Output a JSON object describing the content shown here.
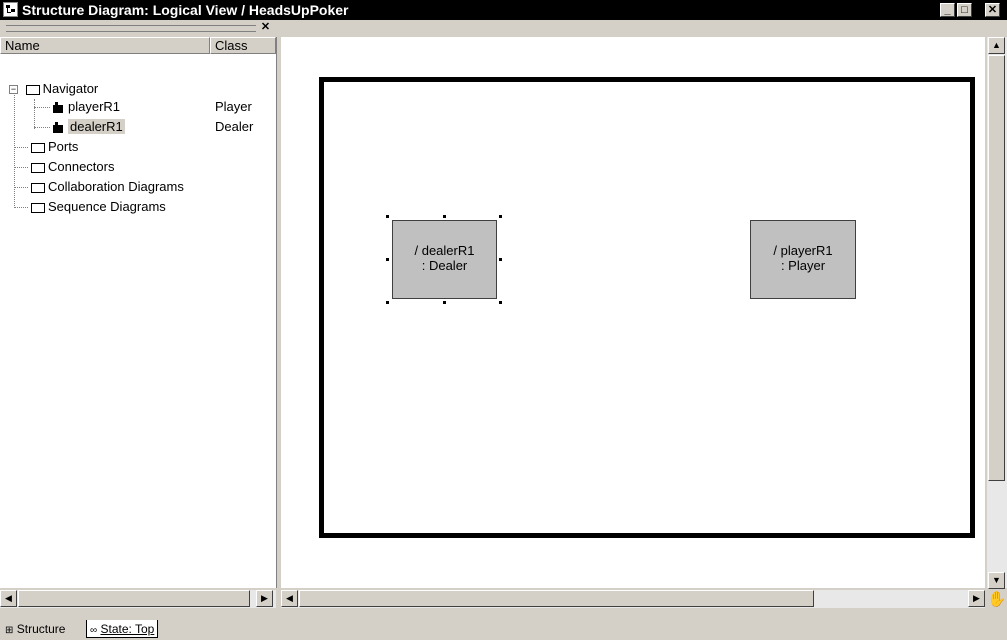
{
  "window": {
    "title": "Structure Diagram: Logical View / HeadsUpPoker",
    "minimize_label": "_",
    "maximize_label": "□",
    "close_label": "✕"
  },
  "browser": {
    "close_label": "✕",
    "columns": {
      "name": "Name",
      "class": "Class"
    },
    "tree": {
      "navigator": "Navigator",
      "parts": [
        {
          "name": "playerR1",
          "class": "Player"
        },
        {
          "name": "dealerR1",
          "class": "Dealer"
        }
      ],
      "folders": [
        "Ports",
        "Connectors",
        "Collaboration Diagrams",
        "Sequence Diagrams"
      ]
    }
  },
  "diagram": {
    "parts": [
      {
        "line1": "/ dealerR1",
        "line2": ": Dealer",
        "selected": true
      },
      {
        "line1": "/ playerR1",
        "line2": ": Player",
        "selected": false
      }
    ]
  },
  "tabs": [
    {
      "label": "Structure",
      "icon": "structure-icon",
      "active": true
    },
    {
      "label": "State: Top",
      "icon": "state-icon",
      "active": false
    }
  ],
  "colors": {
    "titlebar": "#000000",
    "part_fill": "#c0c0c0",
    "chrome": "#d4d0c8"
  }
}
